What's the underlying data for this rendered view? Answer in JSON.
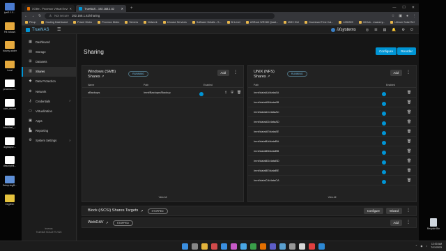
{
  "desktop": {
    "icons": [
      {
        "label": "ipaf1.1.0...",
        "color": "#4a7bd0"
      },
      {
        "label": "FB follows",
        "color": "#e5a93d"
      },
      {
        "label": "busniy adder",
        "color": "#e5a93d"
      },
      {
        "label": "Lmal",
        "color": "#e5a93d"
      },
      {
        "label": "proxmox-v...",
        "color": "#ffffff"
      },
      {
        "label": "com_recom",
        "color": "#ffffff"
      },
      {
        "label": "blocklast_...",
        "color": "#ffffff"
      },
      {
        "label": "digitalyse...",
        "color": "#ffffff"
      },
      {
        "label": "descriptifli...",
        "color": "#ffffff"
      },
      {
        "label": "Setup-tegB...",
        "color": "#5e8fd6"
      },
      {
        "label": "tregfelm",
        "color": "#e5c23d"
      }
    ],
    "recycle_bin": "Recycle Bin"
  },
  "browser": {
    "tabs": [
      {
        "label": "XOlite - Proxmox Virtual Environment",
        "active": false,
        "color": "#e57000"
      },
      {
        "label": "TrueNAS - 192.168.1.62",
        "active": true,
        "color": "#0095d5"
      }
    ],
    "new_tab": "+",
    "not_secure": "Not secure",
    "url": "192.168.1.62/sharing",
    "bookmarks": [
      "Pinup",
      "Hosting Dashboard",
      "Power Distro",
      "Proxmox Distro",
      "Servers",
      "Network",
      "Inhouse Services",
      "Software Details - S...",
      "BI Level",
      "ASRock WRX80 Quad...",
      "MMX GUI",
      "Download Time Cal...",
      "1235399",
      "GitHub - mazonry...",
      "Lithium Solar Ref"
    ]
  },
  "truenas": {
    "brand": "TrueNAS",
    "vendor": "iXsystems",
    "nav": [
      {
        "label": "Dashboard",
        "icon": "dashboard-icon",
        "glyph": "▦",
        "active": false,
        "has_children": false
      },
      {
        "label": "Storage",
        "icon": "storage-icon",
        "glyph": "▤",
        "active": false,
        "has_children": false
      },
      {
        "label": "Datasets",
        "icon": "datasets-icon",
        "glyph": "⊞",
        "active": false,
        "has_children": false
      },
      {
        "label": "Shares",
        "icon": "shares-icon",
        "glyph": "▥",
        "active": true,
        "has_children": false
      },
      {
        "label": "Data Protection",
        "icon": "shield-icon",
        "glyph": "◆",
        "active": false,
        "has_children": false
      },
      {
        "label": "Network",
        "icon": "network-icon",
        "glyph": "⊕",
        "active": false,
        "has_children": false
      },
      {
        "label": "Credentials",
        "icon": "key-icon",
        "glyph": "⚷",
        "active": false,
        "has_children": true
      },
      {
        "label": "Virtualization",
        "icon": "monitor-icon",
        "glyph": "▭",
        "active": false,
        "has_children": false
      },
      {
        "label": "Apps",
        "icon": "apps-icon",
        "glyph": "▣",
        "active": false,
        "has_children": false
      },
      {
        "label": "Reporting",
        "icon": "chart-icon",
        "glyph": "▙",
        "active": false,
        "has_children": false
      },
      {
        "label": "System Settings",
        "icon": "gear-icon",
        "glyph": "⚙",
        "active": false,
        "has_children": true
      }
    ],
    "footer_line1": "truenas",
    "footer_line2": "TrueNAS SCALE ® 2023",
    "page_title": "Sharing",
    "configure_label": "Configure",
    "reorder_label": "Reorder",
    "smb": {
      "title_line1": "Windows (SMB)",
      "title_line2": "Shares",
      "status": "RUNNING",
      "add_label": "Add",
      "col_name": "Name",
      "col_path": "Path",
      "col_enabled": "Enabled",
      "rows": [
        {
          "name": "sBackups",
          "path": "/mnt/Backups/Backup",
          "enabled": true
        }
      ],
      "view_all": "View All"
    },
    "nfs": {
      "title_line1": "UNIX (NFS)",
      "title_line2": "Shares",
      "status": "RUNNING",
      "add_label": "Add",
      "col_path": "Path",
      "col_enabled": "Enabled",
      "rows": [
        {
          "path": "/mnt/dataAA/dataAA",
          "enabled": true
        },
        {
          "path": "/mnt/dataAB/dataAB",
          "enabled": true
        },
        {
          "path": "/mnt/dataAC/dataAC",
          "enabled": true
        },
        {
          "path": "/mnt/dataAD/dataAD",
          "enabled": true
        },
        {
          "path": "/mnt/dataAE/dataAE",
          "enabled": true
        },
        {
          "path": "/mnt/dataBA/dataBA",
          "enabled": true
        },
        {
          "path": "/mnt/dataBB/dataBB",
          "enabled": true
        },
        {
          "path": "/mnt/dataBD/dataBD",
          "enabled": true
        },
        {
          "path": "/mnt/dataBE/dataBE",
          "enabled": true
        },
        {
          "path": "/mnt/dataCA/dataCA",
          "enabled": true
        }
      ],
      "view_all": "View All"
    },
    "iscsi": {
      "title": "Block (iSCSI) Shares Targets",
      "status": "STOPPED",
      "configure_label": "Configure",
      "wizard_label": "Wizard"
    },
    "webdav": {
      "title": "WebDAV",
      "status": "STOPPED",
      "add_label": "Add"
    }
  },
  "taskbar": {
    "time": "12:00 AM",
    "date": "7/11/2023",
    "apps": [
      "#3b8fe0",
      "#888888",
      "#e4b43c",
      "#d24b4b",
      "#3b8fe0",
      "#c85ac8",
      "#49a7e6",
      "#3aa04a",
      "#e57000",
      "#5e5ec8",
      "#5aa0d0",
      "#999999",
      "#d8d8d8",
      "#e04040",
      "#2d89d5"
    ]
  },
  "colors": {
    "accent": "#0095d5",
    "running": "#71bfe8",
    "page_bg": "#161616",
    "card_bg": "#222222"
  }
}
